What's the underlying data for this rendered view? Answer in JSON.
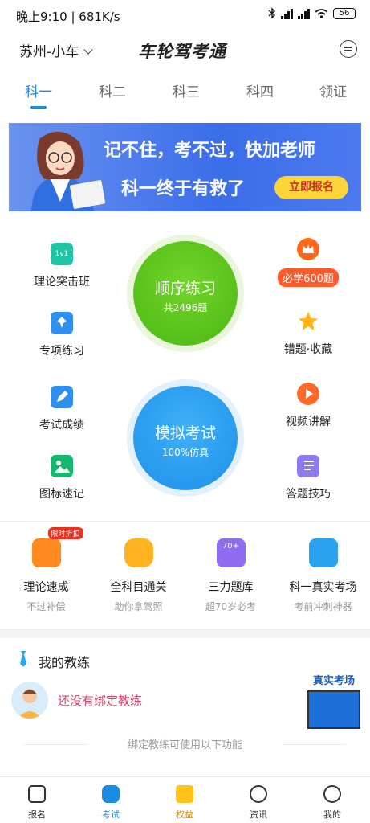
{
  "status_bar": {
    "time_info": "晚上9:10 | 681K/s",
    "battery": "56"
  },
  "header": {
    "city": "苏州-小车",
    "logo": "车轮驾考通"
  },
  "tabs": [
    "科一",
    "科二",
    "科三",
    "科四",
    "领证"
  ],
  "banner": {
    "line1": "记不住，考不过，快加老师",
    "line2": "科一终于有救了",
    "button": "立即报名"
  },
  "practice": {
    "left": [
      "理论突击班",
      "专项练习",
      "考试成绩",
      "图标速记"
    ],
    "right": [
      "必学600题",
      "错题·收藏",
      "视频讲解",
      "答题技巧"
    ],
    "sequence": {
      "title": "顺序练习",
      "sub": "共2496题"
    },
    "mock": {
      "title": "模拟考试",
      "sub": "100%仿真"
    },
    "one_on_one_label": "1v1"
  },
  "features": [
    {
      "name": "理论速成",
      "sub": "不过补偿",
      "badge": "限时折扣"
    },
    {
      "name": "全科目通关",
      "sub": "助你拿驾照"
    },
    {
      "name": "三力题库",
      "sub": "超70岁必考",
      "badge": "70+"
    },
    {
      "name": "科一真实考场",
      "sub": "考前冲刺神器"
    }
  ],
  "coach": {
    "title": "我的教练",
    "empty": "还没有绑定教练",
    "real_exam": "真实考场",
    "bind_hint": "绑定教练可使用以下功能"
  },
  "nav": [
    "报名",
    "考试",
    "权益",
    "资讯",
    "我的"
  ],
  "colors": {
    "accent": "#1a8de3",
    "green": "#54c11b",
    "blue": "#2197ee",
    "pink": "#e0416b"
  }
}
